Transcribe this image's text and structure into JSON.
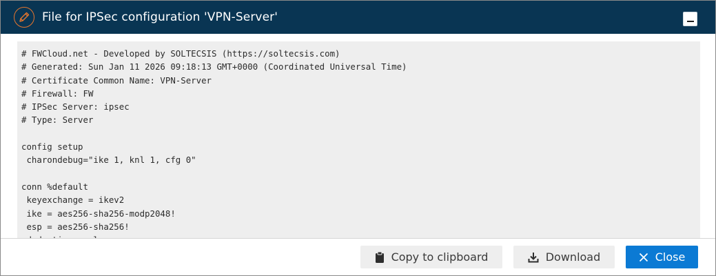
{
  "window": {
    "title": "File for IPSec configuration 'VPN-Server'",
    "title_icon": "pencil-icon",
    "minimize_icon": "minimize-icon"
  },
  "file_content": {
    "lines": [
      "# FWCloud.net - Developed by SOLTECSIS (https://soltecsis.com)",
      "# Generated: Sun Jan 11 2026 09:18:13 GMT+0000 (Coordinated Universal Time)",
      "# Certificate Common Name: VPN-Server",
      "# Firewall: FW",
      "# IPSec Server: ipsec",
      "# Type: Server",
      "",
      "config setup",
      " charondebug=\"ike 1, knl 1, cfg 0\"",
      "",
      "conn %default",
      " keyexchange = ikev2",
      " ike = aes256-sha256-modp2048!",
      " esp = aes256-sha256!",
      " dpdaction = clear"
    ]
  },
  "buttons": {
    "copy_label": "Copy to clipboard",
    "copy_icon": "clipboard-icon",
    "download_label": "Download",
    "download_icon": "download-icon",
    "close_label": "Close",
    "close_icon": "close-icon"
  },
  "colors": {
    "titlebar": "#093553",
    "accent": "#e8762d",
    "primary_button": "#0b7ad4",
    "secondary_button": "#eeeeee",
    "code_background": "#eeeeee"
  }
}
